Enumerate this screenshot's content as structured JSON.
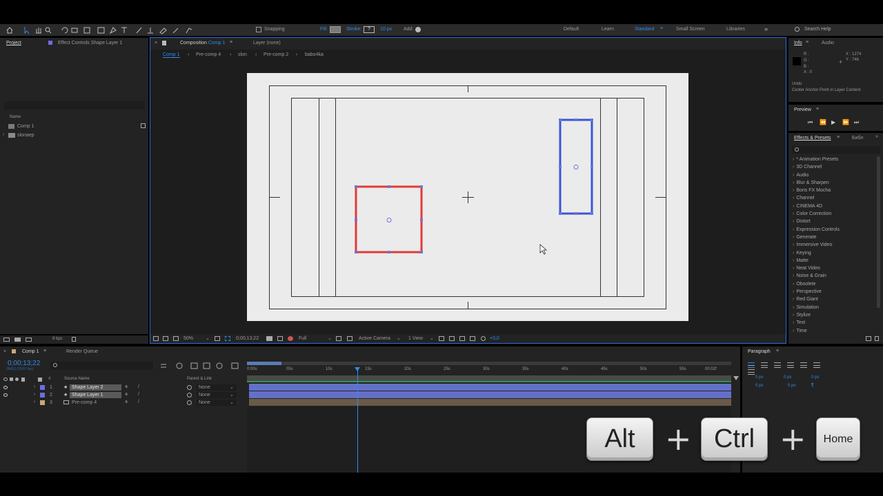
{
  "toolbar": {
    "snapping": "Snapping",
    "fill_label": "Fill:",
    "stroke_label": "Stroke:",
    "stroke_value": "?",
    "stroke_px": "10 px",
    "add_label": "Add:",
    "workspaces": [
      "Default",
      "Learn",
      "Standard",
      "Small Screen",
      "Libraries"
    ],
    "search_help": "Search Help"
  },
  "project": {
    "tab": "Project",
    "effect_controls_tab": "Effect Controls Shape Layer 1",
    "name_header": "Name",
    "items": [
      "Comp 1",
      "slonaep"
    ]
  },
  "composition": {
    "tab_prefix": "Composition",
    "tab_name": "Comp 1",
    "layer_tab": "Layer (none)",
    "breadcrumbs": [
      "Comp 1",
      "Pre-comp 4",
      "slon",
      "Pre-comp 2",
      "babo4ka"
    ]
  },
  "viewer_footer": {
    "zoom": "50%",
    "timecode": "0;00;13;22",
    "resolution": "Full",
    "camera": "Active Camera",
    "view": "1 View",
    "exposure": "+0,0"
  },
  "info": {
    "tab": "Info",
    "audio_tab": "Audio",
    "r": "R :",
    "g": "G :",
    "b": "B :",
    "a": "A : 0",
    "x": "X : 1274",
    "y": "Y : 746",
    "undo": "Undo",
    "undo_action": "Center Anchor Point in Layer Content"
  },
  "preview": {
    "tab": "Preview"
  },
  "effects": {
    "tab": "Effects & Presets",
    "second_tab": "Библ",
    "items": [
      "* Animation Presets",
      "3D Channel",
      "Audio",
      "Blur & Sharpen",
      "Boris FX Mocha",
      "Channel",
      "CINEMA 4D",
      "Color Correction",
      "Distort",
      "Expression Controls",
      "Generate",
      "Immersive Video",
      "Keying",
      "Matte",
      "Neat Video",
      "Noise & Grain",
      "Obsolete",
      "Perspective",
      "Red Giant",
      "Simulation",
      "Stylize",
      "Text",
      "Time"
    ]
  },
  "bottom_left": {
    "bpc": "8 bpc"
  },
  "timeline": {
    "tab": "Comp 1",
    "render_queue": "Render Queue",
    "timecode": "0;00;13;22",
    "fps": "00412 (29.97 fps)",
    "col_source": "Source Name",
    "col_parent": "Parent & Link",
    "layers": [
      {
        "num": "1",
        "name": "Shape Layer 2",
        "parent": "None"
      },
      {
        "num": "2",
        "name": "Shape Layer 1",
        "parent": "None"
      },
      {
        "num": "3",
        "name": "Pre-comp 4",
        "parent": "None"
      }
    ],
    "ruler": [
      "0:00s",
      "05s",
      "10s",
      "15s",
      "20s",
      "25s",
      "30s",
      "35s",
      "40s",
      "45s",
      "50s",
      "55s",
      "00:02f"
    ],
    "playhead_seconds": 13.7
  },
  "paragraph": {
    "tab": "Paragraph",
    "px1": "0 px",
    "px2": "0 px",
    "px3": "0 px",
    "px4": "0 px",
    "px5": "0 px"
  },
  "keys": [
    "Alt",
    "Ctrl",
    "Home"
  ],
  "colors": {
    "accent": "#2d8ceb",
    "red_shape": "#e03a3a",
    "blue_shape": "#3b55d6",
    "layer_bar": "#6470c8"
  }
}
